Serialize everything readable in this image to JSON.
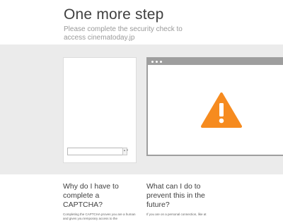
{
  "header": {
    "title": "One more step",
    "subtitle": "Please complete the security check to access cinematoday.jp"
  },
  "captcha": {
    "scroll_glyph": "▲▼"
  },
  "warning": {
    "color": "#f68b1f",
    "icon": "exclamation-warning-icon"
  },
  "info": {
    "why_heading": "Why do I have to complete a CAPTCHA?",
    "why_text": "Completing the CAPTCHA proves you are a human and gives you temporary access to the",
    "what_heading": "What can I do to prevent this in the future?",
    "what_text": "If you are on a personal connection, like at"
  }
}
